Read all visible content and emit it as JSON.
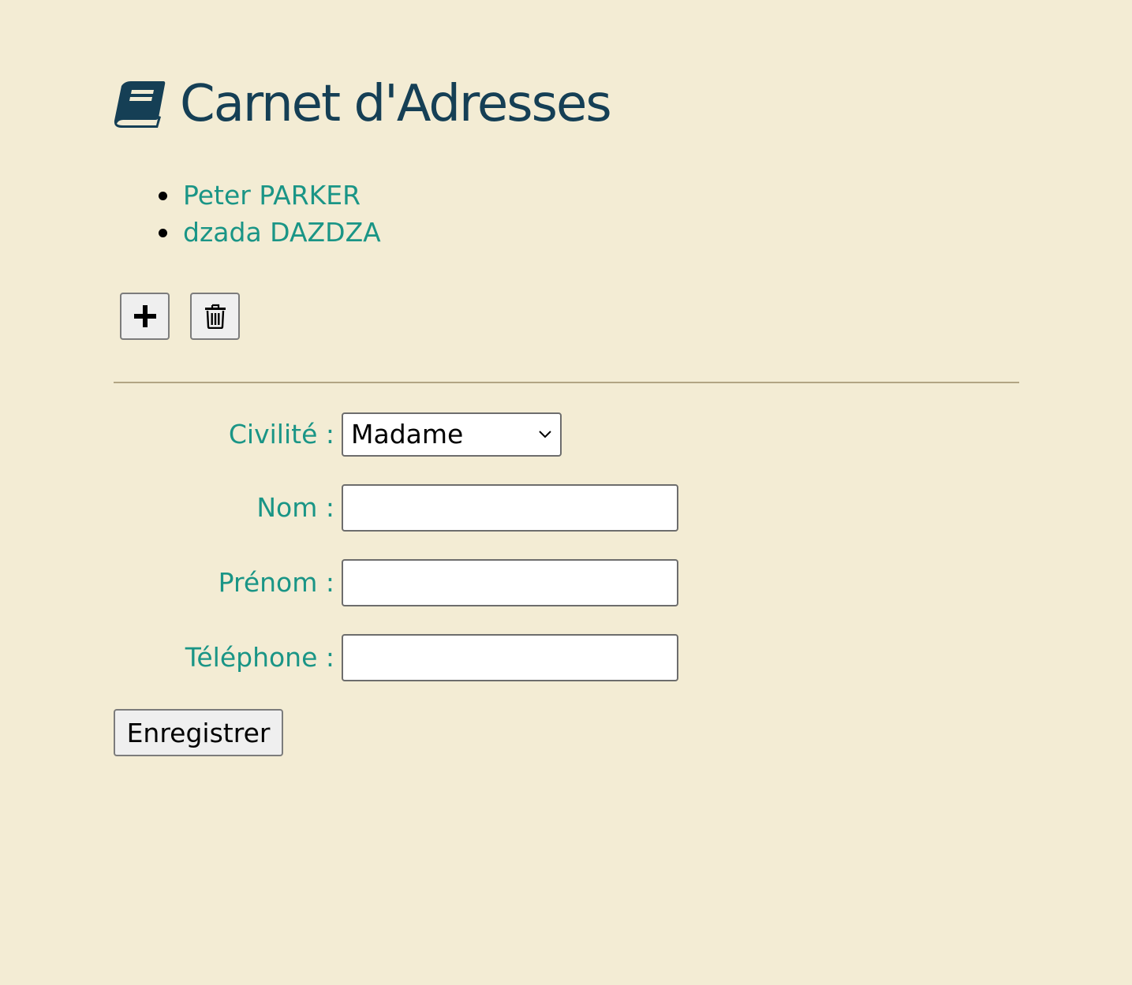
{
  "header": {
    "title": "Carnet d'Adresses",
    "icon": "book-icon"
  },
  "contacts": [
    {
      "label": "Peter PARKER"
    },
    {
      "label": "dzada DAZDZA"
    }
  ],
  "toolbar": {
    "add_icon": "plus-icon",
    "delete_icon": "trash-icon"
  },
  "form": {
    "civilite": {
      "label": "Civilité :",
      "selected": "Madame"
    },
    "nom": {
      "label": "Nom :",
      "value": ""
    },
    "prenom": {
      "label": "Prénom :",
      "value": ""
    },
    "telephone": {
      "label": "Téléphone :",
      "value": ""
    },
    "submit_label": "Enregistrer"
  },
  "colors": {
    "background": "#f3ecd4",
    "title": "#153f55",
    "accent": "#1a9586",
    "divider": "#b2a584"
  }
}
